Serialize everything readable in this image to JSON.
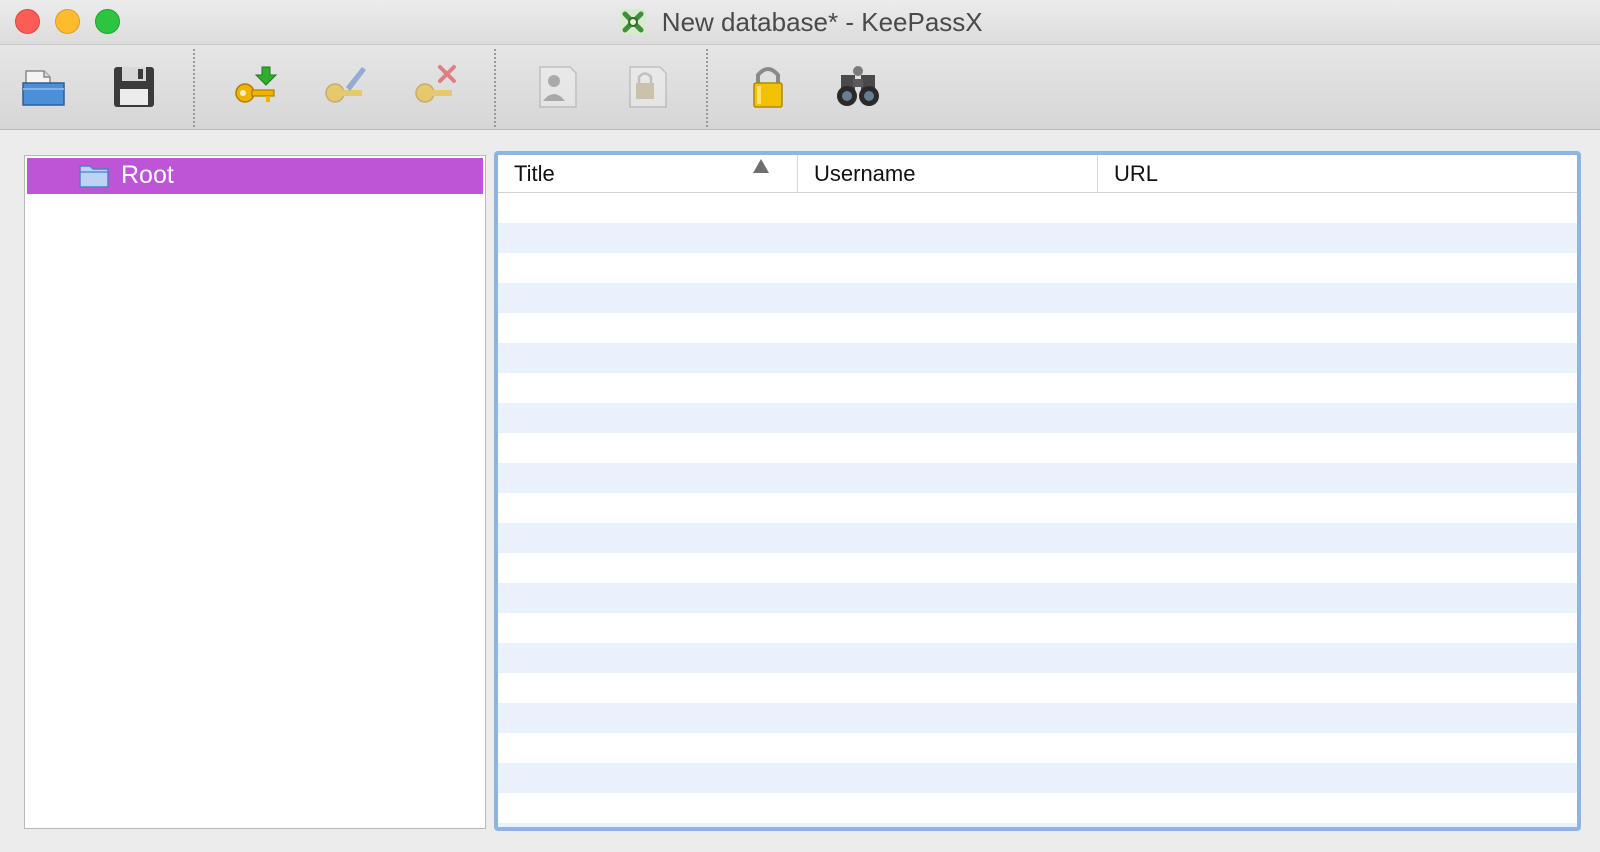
{
  "window": {
    "title": "New database* - KeePassX",
    "app_icon": "keepassx-icon"
  },
  "toolbar": {
    "buttons": [
      {
        "name": "open-database-button",
        "icon": "open-folder-icon",
        "enabled": true
      },
      {
        "name": "save-database-button",
        "icon": "floppy-disk-icon",
        "enabled": true
      },
      {
        "name": "add-entry-button",
        "icon": "key-add-icon",
        "enabled": true
      },
      {
        "name": "edit-entry-button",
        "icon": "key-edit-icon",
        "enabled": false
      },
      {
        "name": "delete-entry-button",
        "icon": "key-delete-icon",
        "enabled": false
      },
      {
        "name": "copy-username-button",
        "icon": "user-card-icon",
        "enabled": false
      },
      {
        "name": "copy-password-button",
        "icon": "lock-card-icon",
        "enabled": false
      },
      {
        "name": "lock-database-button",
        "icon": "padlock-icon",
        "enabled": true
      },
      {
        "name": "search-button",
        "icon": "binoculars-icon",
        "enabled": true
      }
    ]
  },
  "groups": {
    "root_label": "Root",
    "selected_color": "#be55d6"
  },
  "entries": {
    "columns": {
      "title": "Title",
      "username": "Username",
      "url": "URL"
    },
    "sort_column": "Title",
    "sort_direction": "ascending",
    "rows": []
  },
  "colors": {
    "selection": "#be55d6",
    "focus_ring": "#8db4e2",
    "row_alt": "#e9f1fd"
  }
}
